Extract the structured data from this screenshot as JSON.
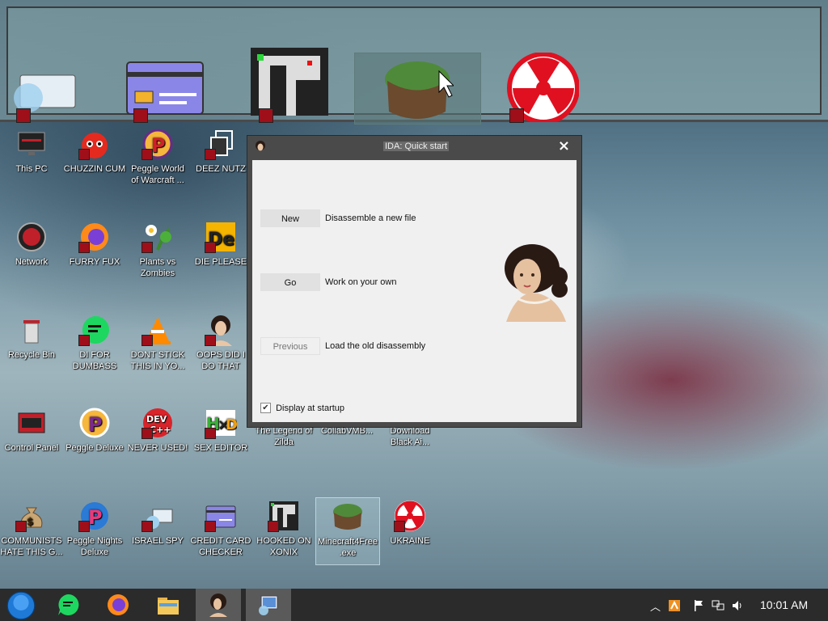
{
  "dialog": {
    "title": "IDA: Quick start",
    "close": "×",
    "actions": [
      {
        "button": "New",
        "desc": "Disassemble a new file",
        "enabled": true
      },
      {
        "button": "Go",
        "desc": "Work on your own",
        "enabled": true
      },
      {
        "button": "Previous",
        "desc": "Load the old disassembly",
        "enabled": false
      }
    ],
    "startup_check": {
      "label": "Display at startup",
      "checked": true,
      "mark": "✔"
    }
  },
  "desktop_icons": [
    {
      "label": "This PC",
      "icon": "monitor-icon"
    },
    {
      "label": "CHUZZIN CUM",
      "icon": "chuzzle-icon"
    },
    {
      "label": "Peggle World of Warcraft ...",
      "icon": "peggle-icon"
    },
    {
      "label": "DEEZ NUTZ",
      "icon": "copy-icon"
    },
    {
      "label": "Network",
      "icon": "network-icon"
    },
    {
      "label": "FURRY FUX",
      "icon": "firefox-icon"
    },
    {
      "label": "Plants vs Zombies",
      "icon": "plant-icon"
    },
    {
      "label": "DIE PLEASE",
      "icon": "de-icon"
    },
    {
      "label": "Recycle Bin",
      "icon": "trash-icon"
    },
    {
      "label": "DI FOR DUMBASS",
      "icon": "chat-icon"
    },
    {
      "label": "DONT STICK THIS IN YO...",
      "icon": "vlc-icon"
    },
    {
      "label": "OOPS DID I DO THAT",
      "icon": "portrait-icon"
    },
    {
      "label": "Control Panel",
      "icon": "control-panel-icon"
    },
    {
      "label": "Peggle Deluxe",
      "icon": "peggle-icon"
    },
    {
      "label": "NEVER USED!",
      "icon": "devcpp-icon"
    },
    {
      "label": "SEX EDITOR",
      "icon": "hxd-icon"
    },
    {
      "label": "The Legend of Zilda",
      "icon": "game-icon"
    },
    {
      "label": "CollabVMB...",
      "icon": "app-icon"
    },
    {
      "label": "Download Black Ai...",
      "icon": "app-icon"
    },
    {
      "label": "COMMUNISTS HATE THIS G...",
      "icon": "money-bag-icon"
    },
    {
      "label": "Peggle Nights Deluxe",
      "icon": "peggle-icon"
    },
    {
      "label": "ISRAEL SPY",
      "icon": "spy-icon"
    },
    {
      "label": "CREDIT CARD CHECKER",
      "icon": "card-icon"
    },
    {
      "label": "HOOKED ON XONIX",
      "icon": "xonix-icon"
    },
    {
      "label": "Minecraft4Free .exe",
      "icon": "grass-block-icon"
    },
    {
      "label": "UKRAINE",
      "icon": "radiation-icon"
    }
  ],
  "taskbar": {
    "clock": "10:01 AM",
    "colors": {
      "bar": "#2b2b2b",
      "active": "#5a5a5a"
    }
  }
}
